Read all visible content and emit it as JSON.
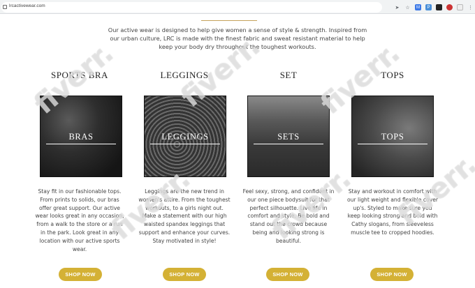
{
  "browser": {
    "url": "lrcactivewear.com",
    "toolbar_icons": [
      "send-icon",
      "star-icon",
      "mail-icon",
      "extension-icon",
      "cast-icon",
      "profile-icon",
      "extension-puzzle-icon",
      "menu-icon"
    ]
  },
  "intro": {
    "text": "Our active wear is designed to help give women a sense of style & strength. Inspired from our urban culture, LRC is made with the finest fabric and sweat resistant material to help keep your body dry throughout the toughest workouts."
  },
  "categories": [
    {
      "heading": "SPORTS BRA",
      "tile_label": "BRAS",
      "description": "Stay fit in our fashionable tops. From prints to solids, our bras offer great support. Our active wear looks great in any occasion, from a walk to the store or a run in the park. Look great in any location with our active sports wear.",
      "button": "SHOP NOW"
    },
    {
      "heading": "LEGGINGS",
      "tile_label": "LEGGINGS",
      "description": "Leggings are the new trend in women's attire. From the toughest workouts, to a girls night out. Make a statement with our high waisted spandex leggings that support and enhance your curves. Stay motivated in style!",
      "button": "SHOP NOW"
    },
    {
      "heading": "SET",
      "tile_label": "SETS",
      "description": "Feel sexy, strong, and confident in our one piece bodysuit for that perfect silhouette. Live life in comfort and style. Be bold and stand out the crowd because being and looking strong is beautiful.",
      "button": "SHOP NOW"
    },
    {
      "heading": "TOPS",
      "tile_label": "TOPS",
      "description": "Stay and workout in comfort with our light weight and flexible cover up's.  Styled to make sure you keep looking strong and bold with Cathy slogans, from sleeveless muscle tee to cropped hoodies.",
      "button": "SHOP NOW"
    }
  ],
  "watermark": "fiverr.",
  "colors": {
    "button": "#d4b135",
    "divider": "#c5a25a"
  }
}
